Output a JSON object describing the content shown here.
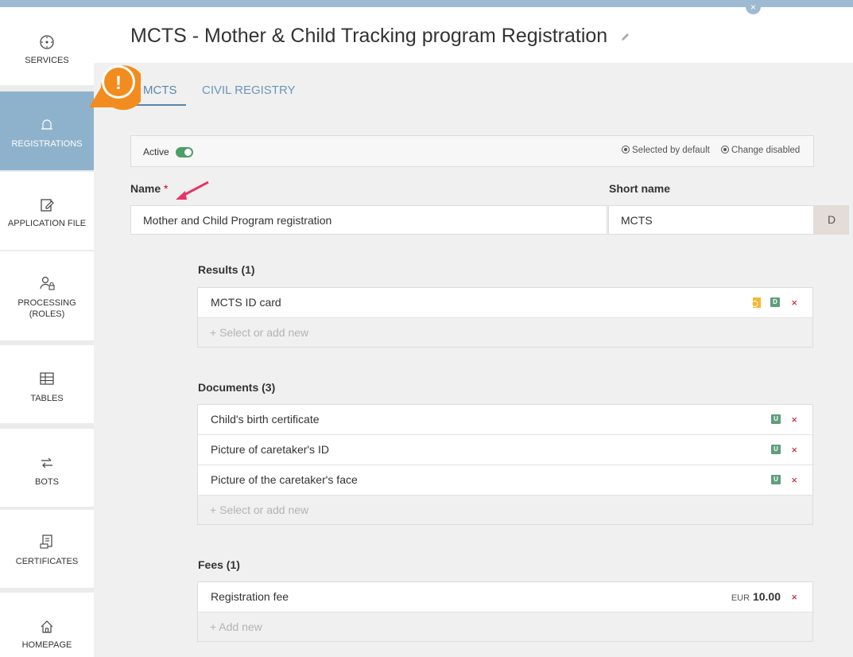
{
  "app": {
    "title": "MCTS - Mother & Child Tracking program Registration",
    "close_symbol": "×",
    "collapse_symbol": "‹"
  },
  "sidebar": {
    "items": [
      {
        "label": "SERVICES",
        "icon": "services-icon"
      },
      {
        "label": "REGISTRATIONS",
        "icon": "registrations-icon",
        "active": true
      },
      {
        "label": "APPLICATION FILE",
        "icon": "application-file-icon"
      },
      {
        "label": "PROCESSING (ROLES)",
        "icon": "processing-roles-icon"
      },
      {
        "label": "TABLES",
        "icon": "tables-icon"
      },
      {
        "label": "BOTS",
        "icon": "bots-icon"
      },
      {
        "label": "CERTIFICATES",
        "icon": "certificates-icon"
      },
      {
        "label": "HOMEPAGE",
        "icon": "homepage-icon"
      }
    ]
  },
  "tabs": [
    {
      "label": "MCTS",
      "active": true
    },
    {
      "label": "CIVIL REGISTRY",
      "active": false
    }
  ],
  "active_bar": {
    "active_label": "Active",
    "active_on": true,
    "selected_by_default": "Selected by default",
    "change_disabled": "Change disabled"
  },
  "form": {
    "name_label": "Name",
    "required_mark": "*",
    "name_value": "Mother and Child Program registration",
    "short_name_label": "Short name",
    "short_name_value": "MCTS",
    "d_button": "D"
  },
  "results": {
    "title": "Results (1)",
    "items": [
      {
        "label": "MCTS ID card",
        "badge": "D"
      }
    ],
    "add_placeholder": "+ Select or add new"
  },
  "documents": {
    "title": "Documents (3)",
    "items": [
      {
        "label": "Child's birth certificate",
        "badge": "U"
      },
      {
        "label": "Picture of caretaker's ID",
        "badge": "U"
      },
      {
        "label": "Picture of the caretaker's face",
        "badge": "U"
      }
    ],
    "add_placeholder": "+ Select or add new"
  },
  "fees": {
    "title": "Fees (1)",
    "items": [
      {
        "label": "Registration fee",
        "currency": "EUR",
        "amount": "10.00"
      }
    ],
    "add_placeholder": "+ Add new"
  },
  "remove_symbol": "×",
  "annotation": {
    "alert_symbol": "!"
  },
  "colors": {
    "accent": "#5b86ad",
    "sidebar_active": "#8fb2cc",
    "toggle_on": "#4a9e66",
    "badge": "#5e9e7b",
    "remove": "#d0021b",
    "alert": "#f28c1e",
    "arrow": "#e8326a"
  }
}
